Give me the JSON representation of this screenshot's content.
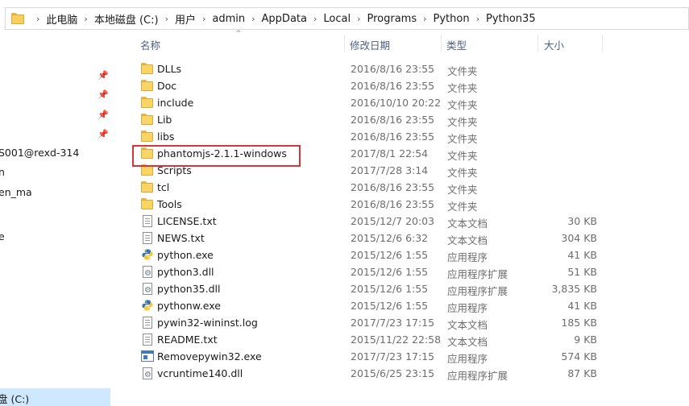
{
  "address_bar": {
    "crumbs": [
      "此电脑",
      "本地磁盘 (C:)",
      "用户",
      "admin",
      "AppData",
      "Local",
      "Programs",
      "Python",
      "Python35"
    ],
    "separator": "›"
  },
  "nav_pane": {
    "items": [
      "S001@rexd-314",
      "n",
      "en_ma",
      "e"
    ],
    "selected_drive": "盘 (C:)",
    "pin_glyph": "📌"
  },
  "columns": {
    "name": "名称",
    "date": "修改日期",
    "type": "类型",
    "size": "大小",
    "sort_indicator": "^"
  },
  "files": [
    {
      "icon": "folder-icon",
      "name": "DLLs",
      "date": "2016/8/16 23:55",
      "type": "文件夹",
      "size": ""
    },
    {
      "icon": "folder-icon",
      "name": "Doc",
      "date": "2016/8/16 23:55",
      "type": "文件夹",
      "size": ""
    },
    {
      "icon": "folder-icon",
      "name": "include",
      "date": "2016/10/10 20:22",
      "type": "文件夹",
      "size": ""
    },
    {
      "icon": "folder-icon",
      "name": "Lib",
      "date": "2016/8/16 23:55",
      "type": "文件夹",
      "size": ""
    },
    {
      "icon": "folder-icon",
      "name": "libs",
      "date": "2016/8/16 23:55",
      "type": "文件夹",
      "size": ""
    },
    {
      "icon": "folder-icon",
      "name": "phantomjs-2.1.1-windows",
      "date": "2017/8/1 22:54",
      "type": "文件夹",
      "size": ""
    },
    {
      "icon": "folder-icon",
      "name": "Scripts",
      "date": "2017/7/28 3:14",
      "type": "文件夹",
      "size": ""
    },
    {
      "icon": "folder-icon",
      "name": "tcl",
      "date": "2016/8/16 23:55",
      "type": "文件夹",
      "size": ""
    },
    {
      "icon": "folder-icon",
      "name": "Tools",
      "date": "2016/8/16 23:55",
      "type": "文件夹",
      "size": ""
    },
    {
      "icon": "text-file-icon",
      "name": "LICENSE.txt",
      "date": "2015/12/7 20:03",
      "type": "文本文档",
      "size": "30 KB"
    },
    {
      "icon": "text-file-icon",
      "name": "NEWS.txt",
      "date": "2015/12/6 6:32",
      "type": "文本文档",
      "size": "304 KB"
    },
    {
      "icon": "python-exe-icon",
      "name": "python.exe",
      "date": "2015/12/6 1:55",
      "type": "应用程序",
      "size": "41 KB"
    },
    {
      "icon": "dll-file-icon",
      "name": "python3.dll",
      "date": "2015/12/6 1:55",
      "type": "应用程序扩展",
      "size": "51 KB"
    },
    {
      "icon": "dll-file-icon",
      "name": "python35.dll",
      "date": "2015/12/6 1:55",
      "type": "应用程序扩展",
      "size": "3,835 KB"
    },
    {
      "icon": "python-exe-icon",
      "name": "pythonw.exe",
      "date": "2015/12/6 1:55",
      "type": "应用程序",
      "size": "41 KB"
    },
    {
      "icon": "text-file-icon",
      "name": "pywin32-wininst.log",
      "date": "2017/7/23 17:15",
      "type": "文本文档",
      "size": "185 KB"
    },
    {
      "icon": "text-file-icon",
      "name": "README.txt",
      "date": "2015/11/22 22:58",
      "type": "文本文档",
      "size": "9 KB"
    },
    {
      "icon": "app-exe-icon",
      "name": "Removepywin32.exe",
      "date": "2017/7/23 17:15",
      "type": "应用程序",
      "size": "574 KB"
    },
    {
      "icon": "dll-file-icon",
      "name": "vcruntime140.dll",
      "date": "2015/6/25 23:15",
      "type": "应用程序扩展",
      "size": "87 KB"
    }
  ],
  "colors": {
    "highlight_border": "#d9343a",
    "selection": "#cde8ff",
    "folder": "#f9d466"
  }
}
